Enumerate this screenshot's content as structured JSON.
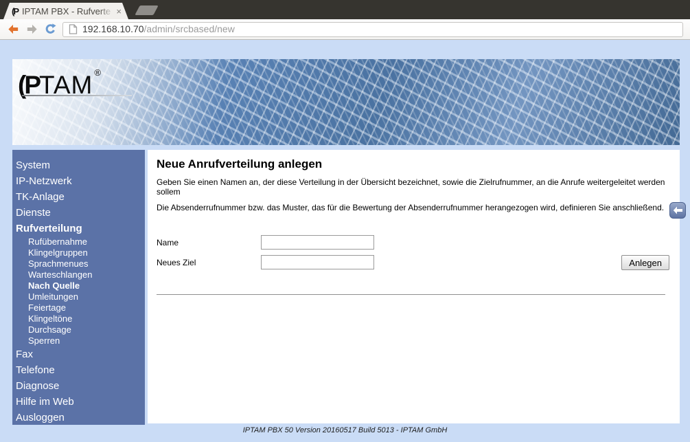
{
  "browser": {
    "tab": {
      "favicon": "(P",
      "title": "IPTAM PBX - Rufverte",
      "close": "×"
    },
    "address": {
      "host": "192.168.10.70",
      "path": "/admin/srcbased/new"
    }
  },
  "header": {
    "logo_bold": "(P",
    "logo_light": "TAM",
    "logo_reg": "®"
  },
  "sidebar": {
    "items": [
      {
        "id": "system",
        "label": "System",
        "level": 0,
        "bold": false
      },
      {
        "id": "ip-netzwerk",
        "label": "IP-Netzwerk",
        "level": 0,
        "bold": false
      },
      {
        "id": "tk-anlage",
        "label": "TK-Anlage",
        "level": 0,
        "bold": false
      },
      {
        "id": "dienste",
        "label": "Dienste",
        "level": 0,
        "bold": false
      },
      {
        "id": "rufverteilung",
        "label": "Rufverteilung",
        "level": 0,
        "bold": true
      },
      {
        "id": "rufuebernahme",
        "label": "Rufübernahme",
        "level": 1,
        "bold": false
      },
      {
        "id": "klingelgruppen",
        "label": "Klingelgruppen",
        "level": 1,
        "bold": false
      },
      {
        "id": "sprachmenues",
        "label": "Sprachmenues",
        "level": 1,
        "bold": false
      },
      {
        "id": "warteschlangen",
        "label": "Warteschlangen",
        "level": 1,
        "bold": false
      },
      {
        "id": "nach-quelle",
        "label": "Nach Quelle",
        "level": 1,
        "bold": true
      },
      {
        "id": "umleitungen",
        "label": "Umleitungen",
        "level": 1,
        "bold": false
      },
      {
        "id": "feiertage",
        "label": "Feiertage",
        "level": 1,
        "bold": false
      },
      {
        "id": "klingeltoene",
        "label": "Klingeltöne",
        "level": 1,
        "bold": false
      },
      {
        "id": "durchsage",
        "label": "Durchsage",
        "level": 1,
        "bold": false
      },
      {
        "id": "sperren",
        "label": "Sperren",
        "level": 1,
        "bold": false
      },
      {
        "id": "fax",
        "label": "Fax",
        "level": 0,
        "bold": false
      },
      {
        "id": "telefone",
        "label": "Telefone",
        "level": 0,
        "bold": false
      },
      {
        "id": "diagnose",
        "label": "Diagnose",
        "level": 0,
        "bold": false
      },
      {
        "id": "hilfe-im-web",
        "label": "Hilfe im Web",
        "level": 0,
        "bold": false
      },
      {
        "id": "ausloggen",
        "label": "Ausloggen",
        "level": 0,
        "bold": false
      }
    ]
  },
  "main": {
    "title": "Neue Anrufverteilung anlegen",
    "intro1": "Geben Sie einen Namen an, der diese Verteilung in der Übersicht bezeichnet, sowie die Zielrufnummer, an die Anrufe weitergeleitet werden sollem",
    "intro2": "Die Absenderrufnummer bzw. das Muster, das für die Bewertung der Absenderrufnummer herangezogen wird, definieren Sie anschließend.",
    "form": {
      "name_label": "Name",
      "name_value": "",
      "target_label": "Neues Ziel",
      "target_value": "",
      "submit_label": "Anlegen"
    }
  },
  "footer": {
    "text": "IPTAM PBX 50 Version 20160517 Build 5013 - IPTAM GmbH"
  },
  "colors": {
    "page_bg": "#cadcf6",
    "sidebar_bg": "#5b72a7",
    "titlebar_bg": "#36342f",
    "back_arrow_orange": "#e2732f",
    "forward_arrow_gray": "#b4b1ac",
    "reload_blue": "#6b9bd2",
    "banner_blue": "#49719f"
  }
}
